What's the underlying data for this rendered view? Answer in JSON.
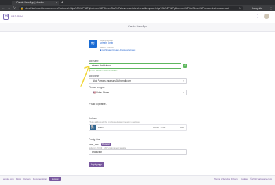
{
  "browser": {
    "tab_title": "Create New App | Heroku",
    "tab_close": "×",
    "new_tab": "+",
    "url": "https://dashboard.heroku.com/new?button-url=https%3A%2F%2Fgithub.com%2FStreamChat%2Fstream-chat-tutorial-react&template=https%3A%2F%2Fgithub.com%2FGetStream%2Fstream-chat-tutorial-react",
    "back": "←",
    "forward": "→",
    "reload": "↻",
    "lock": "🔒",
    "star": "☆",
    "incognito_label": "Incognito",
    "menu": "⋮"
  },
  "header": {
    "logo_letter": "H",
    "brand": "HEROKU",
    "grid_icon": "⋮⋮⋮"
  },
  "subheader": {
    "title": "Create New App"
  },
  "app_info": {
    "logo_glyph": "≋",
    "deploying_label": "Deploying app",
    "app_name": "Stream Chat",
    "stack_label": "Stream Chat API",
    "repo_link": "GetStream/stream-chat-tutorial-react"
  },
  "form": {
    "name_label": "App name",
    "name_value": "stream-chat-tutorial",
    "name_valid_icon": "✓",
    "available_text": "stream-chat-tutorial is available",
    "owner_label": "App owner",
    "owner_value": "Nick Parsons (nparsons08@gmail.com)",
    "region_label": "Choose a region",
    "region_value": "United States",
    "region_flag": "🇺🇸",
    "chevron": "▾",
    "pipeline_label": "+ Add to pipeline...",
    "addons_label": "Add-ons",
    "addons_hint": "These add-ons will be provisioned when the app is deployed",
    "addon_icon": "🐘",
    "addon_name": "Stream",
    "addon_plan": "Heroku · Free",
    "addon_price": "Free",
    "config_label": "Config Vars",
    "config_key": "NODE_ENV",
    "config_required": "Required",
    "config_hint": "Node.js's NODE_ENV environment variable",
    "config_value": "production",
    "deploy_button": "Deploy app"
  },
  "footer": {
    "links_left": [
      "heroku.com",
      "Blogs",
      "Careers",
      "Documentation"
    ],
    "support": "Support",
    "links_right": [
      "Terms of Service",
      "Privacy",
      "Cookies",
      "© 2019 Salesforce.com"
    ]
  },
  "colors": {
    "brand": "#79589f",
    "success": "#5fb85f",
    "link": "#2e6bd1",
    "annotation_arrow": "#f2d73a"
  }
}
